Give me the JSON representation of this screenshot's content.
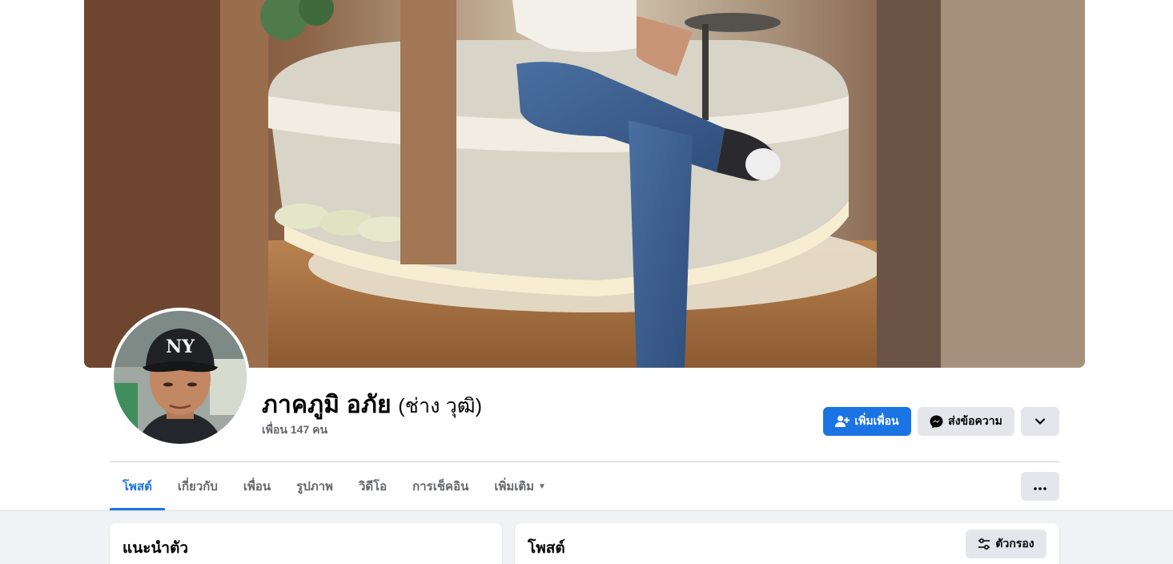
{
  "profile": {
    "name": "ภาคภูมิ อภัย",
    "alternate_name": "(ช่าง วุฒิ)",
    "friends_count": "เพื่อน 147 คน"
  },
  "actions": {
    "add_friend": "เพิ่มเพื่อน",
    "message": "ส่งข้อความ"
  },
  "tabs": [
    {
      "label": "โพสต์",
      "active": true
    },
    {
      "label": "เกี่ยวกับ"
    },
    {
      "label": "เพื่อน"
    },
    {
      "label": "รูปภาพ"
    },
    {
      "label": "วิดีโอ"
    },
    {
      "label": "การเช็คอิน"
    },
    {
      "label": "เพิ่มเติม"
    }
  ],
  "intro_card": {
    "title": "แนะนำตัว"
  },
  "posts_card": {
    "title": "โพสต์",
    "filter_label": "ตัวกรอง"
  },
  "colors": {
    "accent": "#1b74e4",
    "page_bg": "#f0f2f5",
    "secondary_button": "#e4e6eb",
    "muted_text": "#65676b"
  },
  "icons": [
    "user-plus-icon",
    "messenger-icon",
    "chevron-down-icon",
    "caret-down-icon",
    "more-icon",
    "filter-icon"
  ]
}
